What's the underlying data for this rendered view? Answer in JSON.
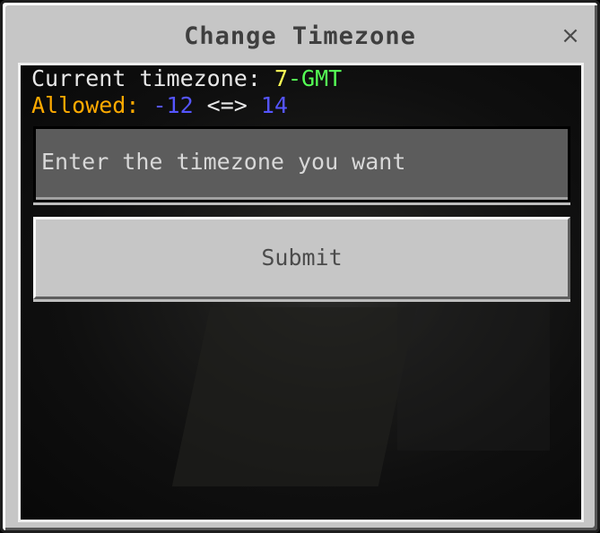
{
  "dialog": {
    "title": "Change Timezone",
    "close_icon": "×"
  },
  "info": {
    "current_label": "Current timezone: ",
    "current_offset": "7",
    "current_suffix": "-GMT",
    "allowed_label": "Allowed: ",
    "allowed_min": "-12",
    "allowed_sep": " <=> ",
    "allowed_max": "14"
  },
  "input": {
    "placeholder": "Enter the timezone you want"
  },
  "submit": {
    "label": "Submit"
  },
  "colors": {
    "panel": "#c6c6c6",
    "current_offset": "#fefe55",
    "current_suffix": "#55fe55",
    "allowed_label": "#ffaa00",
    "allowed_values": "#5555ff"
  }
}
